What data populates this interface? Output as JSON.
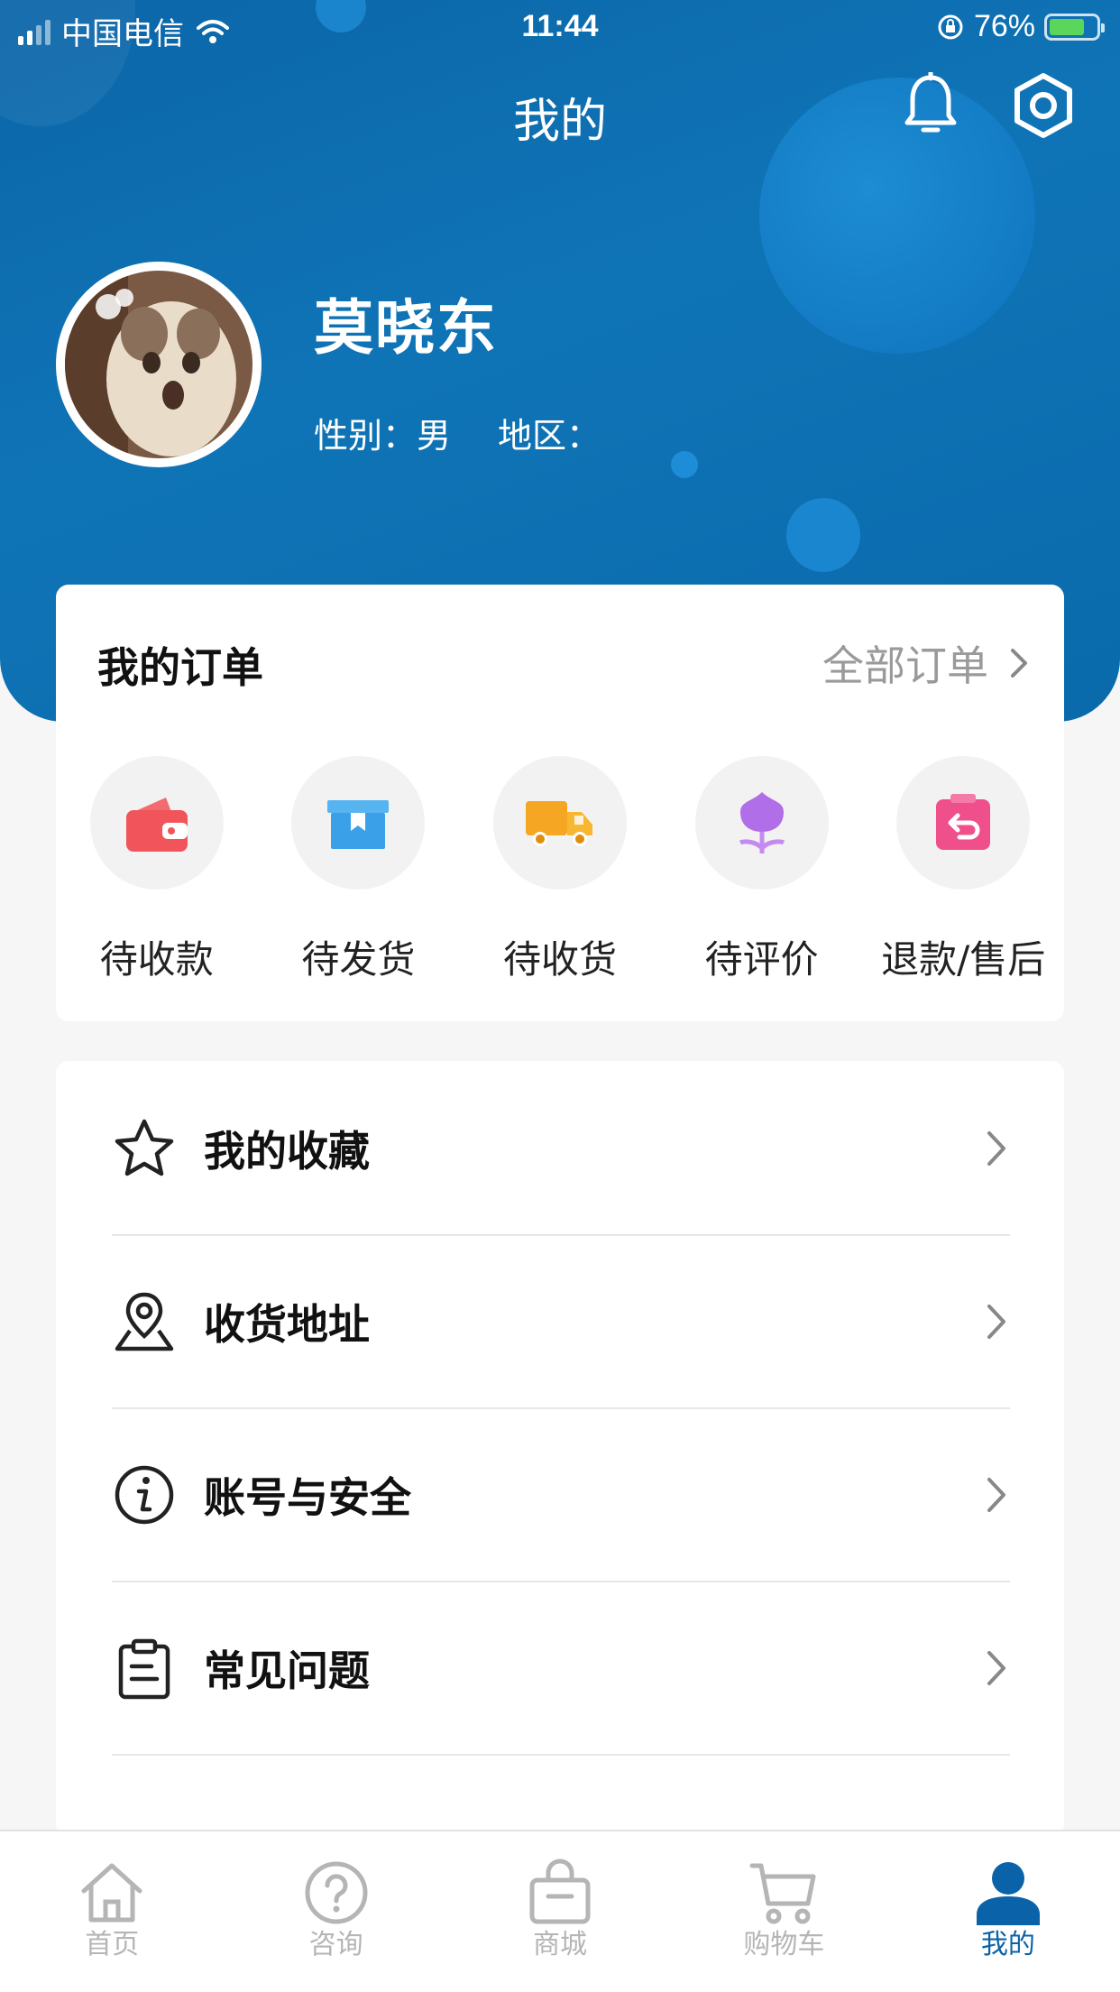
{
  "status_bar": {
    "carrier": "中国电信",
    "time": "11:44",
    "battery": "76%",
    "battery_level": 0.76
  },
  "header": {
    "title": "我的"
  },
  "profile": {
    "name": "莫晓东",
    "gender_label": "性别：",
    "gender": "男",
    "region_label": "地区：",
    "region": ""
  },
  "orders": {
    "title": "我的订单",
    "view_all": "全部订单",
    "items": [
      {
        "label": "待收款",
        "icon": "wallet-icon",
        "color": "#f2545b"
      },
      {
        "label": "待发货",
        "icon": "box-icon",
        "color": "#3aa0e8"
      },
      {
        "label": "待收货",
        "icon": "truck-icon",
        "color": "#f5a623"
      },
      {
        "label": "待评价",
        "icon": "flower-icon",
        "color": "#b06ee8"
      },
      {
        "label": "退款/售后",
        "icon": "refund-icon",
        "color": "#ef4f8b"
      }
    ]
  },
  "menu": {
    "items": [
      {
        "label": "我的收藏",
        "icon": "star-icon"
      },
      {
        "label": "收货地址",
        "icon": "location-icon"
      },
      {
        "label": "账号与安全",
        "icon": "info-icon"
      },
      {
        "label": "常见问题",
        "icon": "clipboard-icon"
      }
    ]
  },
  "tabbar": {
    "items": [
      {
        "label": "首页",
        "icon": "home-icon",
        "active": false
      },
      {
        "label": "咨询",
        "icon": "question-icon",
        "active": false
      },
      {
        "label": "商城",
        "icon": "shopping-bag-icon",
        "active": false
      },
      {
        "label": "购物车",
        "icon": "cart-icon",
        "active": false
      },
      {
        "label": "我的",
        "icon": "user-icon",
        "active": true
      }
    ],
    "active_color": "#0a62a8",
    "inactive_color": "#b5b5b5"
  }
}
